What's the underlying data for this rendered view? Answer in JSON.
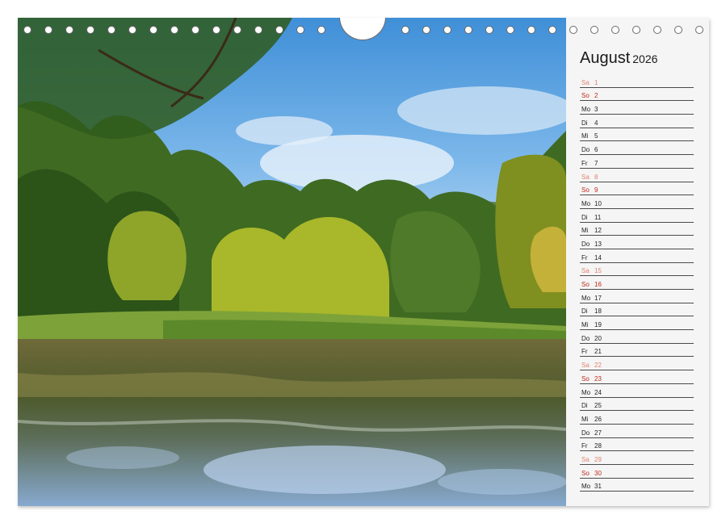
{
  "calendar": {
    "month": "August",
    "year": "2026",
    "days": [
      {
        "day": "Sa",
        "num": "1",
        "type": "sat"
      },
      {
        "day": "So",
        "num": "2",
        "type": "sun"
      },
      {
        "day": "Mo",
        "num": "3",
        "type": "weekday"
      },
      {
        "day": "Di",
        "num": "4",
        "type": "weekday"
      },
      {
        "day": "Mi",
        "num": "5",
        "type": "weekday"
      },
      {
        "day": "Do",
        "num": "6",
        "type": "weekday"
      },
      {
        "day": "Fr",
        "num": "7",
        "type": "weekday"
      },
      {
        "day": "Sa",
        "num": "8",
        "type": "sat"
      },
      {
        "day": "So",
        "num": "9",
        "type": "sun"
      },
      {
        "day": "Mo",
        "num": "10",
        "type": "weekday"
      },
      {
        "day": "Di",
        "num": "11",
        "type": "weekday"
      },
      {
        "day": "Mi",
        "num": "12",
        "type": "weekday"
      },
      {
        "day": "Do",
        "num": "13",
        "type": "weekday"
      },
      {
        "day": "Fr",
        "num": "14",
        "type": "weekday"
      },
      {
        "day": "Sa",
        "num": "15",
        "type": "sat"
      },
      {
        "day": "So",
        "num": "16",
        "type": "sun"
      },
      {
        "day": "Mo",
        "num": "17",
        "type": "weekday"
      },
      {
        "day": "Di",
        "num": "18",
        "type": "weekday"
      },
      {
        "day": "Mi",
        "num": "19",
        "type": "weekday"
      },
      {
        "day": "Do",
        "num": "20",
        "type": "weekday"
      },
      {
        "day": "Fr",
        "num": "21",
        "type": "weekday"
      },
      {
        "day": "Sa",
        "num": "22",
        "type": "sat"
      },
      {
        "day": "So",
        "num": "23",
        "type": "sun"
      },
      {
        "day": "Mo",
        "num": "24",
        "type": "weekday"
      },
      {
        "day": "Di",
        "num": "25",
        "type": "weekday"
      },
      {
        "day": "Mi",
        "num": "26",
        "type": "weekday"
      },
      {
        "day": "Do",
        "num": "27",
        "type": "weekday"
      },
      {
        "day": "Fr",
        "num": "28",
        "type": "weekday"
      },
      {
        "day": "Sa",
        "num": "29",
        "type": "sat"
      },
      {
        "day": "So",
        "num": "30",
        "type": "sun"
      },
      {
        "day": "Mo",
        "num": "31",
        "type": "weekday"
      }
    ]
  },
  "colors": {
    "saturday": "#e0836f",
    "sunday": "#c0281a",
    "weekday": "#222222",
    "sidebar_background": "#f5f5f5"
  },
  "photo": {
    "subject": "park-lake-landscape"
  },
  "binding": {
    "ring_count": 32
  }
}
